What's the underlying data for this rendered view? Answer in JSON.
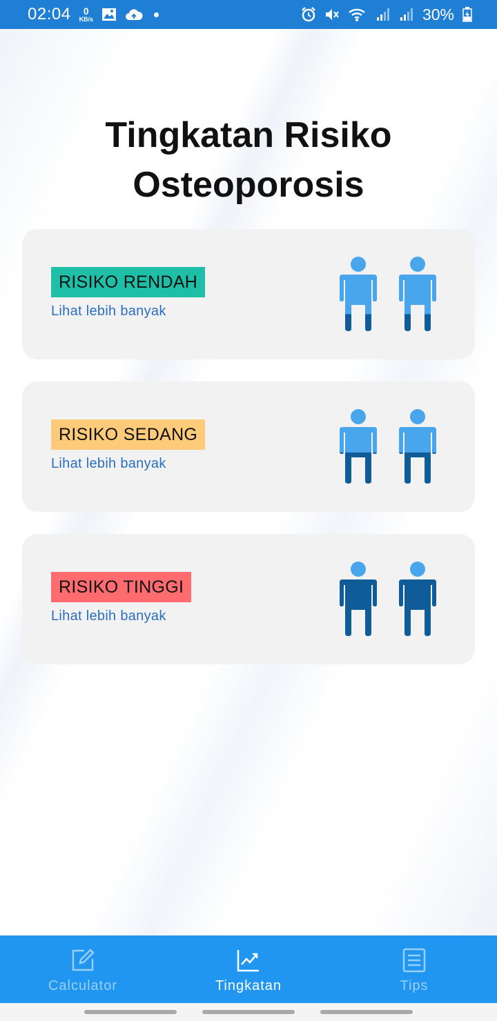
{
  "status_bar": {
    "time": "02:04",
    "net_speed_value": "0",
    "net_speed_unit": "KB/s",
    "battery": "30%",
    "icons": [
      "image-icon",
      "cloud-sync-icon",
      "alarm-icon",
      "mute-icon",
      "wifi-icon",
      "signal-icon",
      "signal-icon",
      "battery-charging-icon"
    ]
  },
  "page": {
    "title_line1": "Tingkatan Risiko",
    "title_line2": "Osteoporosis"
  },
  "levels": [
    {
      "label": "RISIKO RENDAH",
      "link": "Lihat lebih banyak",
      "badge_color": "#1fbfa7",
      "fill_fraction": 0.3
    },
    {
      "label": "RISIKO SEDANG",
      "link": "Lihat lebih banyak",
      "badge_color": "#fdcb7a",
      "fill_fraction": 0.55
    },
    {
      "label": "RISIKO TINGGI",
      "link": "Lihat lebih banyak",
      "badge_color": "#fe6c6f",
      "fill_fraction": 1.0
    }
  ],
  "figure_colors": {
    "light": "#4aa6ec",
    "dark": "#0f5c99"
  },
  "bottom_nav": {
    "items": [
      {
        "label": "Calculator",
        "icon": "edit-icon",
        "active": false
      },
      {
        "label": "Tingkatan",
        "icon": "chart-trend-icon",
        "active": true
      },
      {
        "label": "Tips",
        "icon": "list-icon",
        "active": false
      }
    ]
  }
}
